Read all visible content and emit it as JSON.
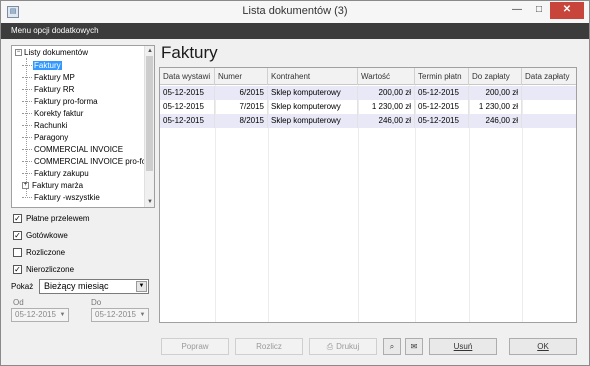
{
  "window": {
    "title": "Lista dokumentów (3)",
    "icon": "document-icon"
  },
  "menubar": {
    "label": "Menu opcji dodatkowych"
  },
  "tree": {
    "root": "Listy dokumentów",
    "items": [
      {
        "label": "Faktury",
        "selected": true
      },
      {
        "label": "Faktury MP"
      },
      {
        "label": "Faktury RR"
      },
      {
        "label": "Faktury pro-forma"
      },
      {
        "label": "Korekty faktur"
      },
      {
        "label": "Rachunki"
      },
      {
        "label": "Paragony"
      },
      {
        "label": "COMMERCIAL INVOICE"
      },
      {
        "label": "COMMERCIAL INVOICE pro-forma"
      },
      {
        "label": "Faktury zakupu"
      },
      {
        "label": "Faktury marża",
        "expandable": true
      },
      {
        "label": "Faktury -wszystkie"
      }
    ]
  },
  "filters": {
    "checkboxes": [
      {
        "label": "Płatne przelewem",
        "checked": true
      },
      {
        "label": "Gotówkowe",
        "checked": true
      },
      {
        "label": "Rozliczone",
        "checked": false
      },
      {
        "label": "Nierozliczone",
        "checked": true
      }
    ],
    "pokaz_label": "Pokaż",
    "pokaz_value": "Bieżący miesiąc",
    "od_label": "Od",
    "do_label": "Do",
    "od_value": "05-12-2015",
    "do_value": "05-12-2015"
  },
  "main": {
    "title": "Faktury",
    "columns": [
      "Data wystawi",
      "Numer",
      "Kontrahent",
      "Wartość",
      "Termin płatn",
      "Do zapłaty",
      "Data zapłaty"
    ],
    "rows": [
      [
        "05-12-2015",
        "6/2015",
        "Sklep komputerowy",
        "200,00 zł",
        "05-12-2015",
        "200,00 zł",
        ""
      ],
      [
        "05-12-2015",
        "7/2015",
        "Sklep komputerowy",
        "1 230,00 zł",
        "05-12-2015",
        "1 230,00 zł",
        ""
      ],
      [
        "05-12-2015",
        "8/2015",
        "Sklep komputerowy",
        "246,00 zł",
        "05-12-2015",
        "246,00 zł",
        ""
      ]
    ]
  },
  "buttons": {
    "popraw": "Popraw",
    "rozlicz": "Rozlicz",
    "drukuj": "Drukuj",
    "usun": "Usuń",
    "ok": "OK"
  }
}
